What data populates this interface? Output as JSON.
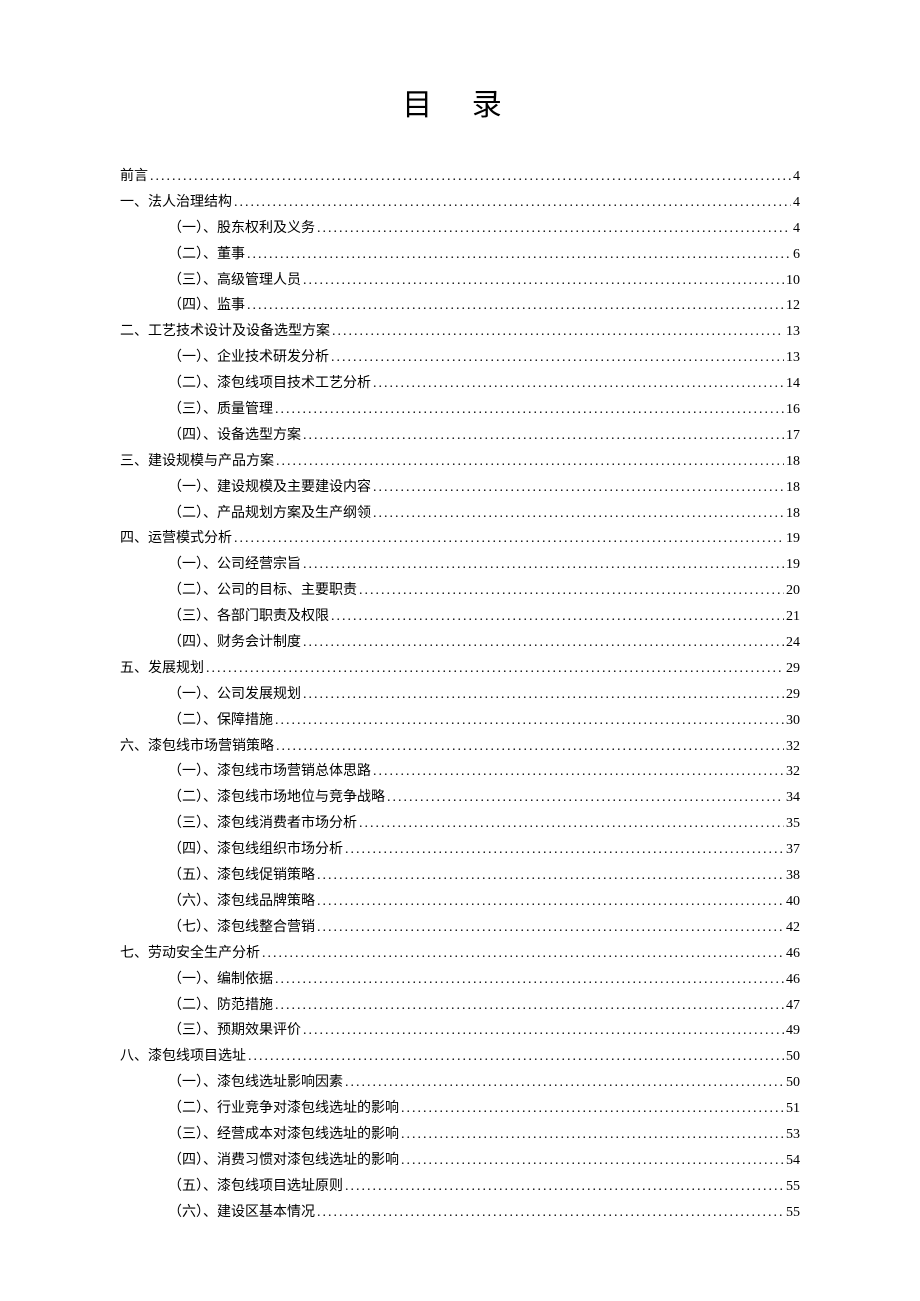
{
  "title": "目 录",
  "entries": [
    {
      "level": 0,
      "label": "前言",
      "page": "4"
    },
    {
      "level": 0,
      "label": "一、法人治理结构",
      "page": "4"
    },
    {
      "level": 1,
      "label": "（一）、股东权利及义务",
      "page": "4"
    },
    {
      "level": 1,
      "label": "（二）、董事",
      "page": "6"
    },
    {
      "level": 1,
      "label": "（三）、高级管理人员",
      "page": "10"
    },
    {
      "level": 1,
      "label": "（四）、监事",
      "page": "12"
    },
    {
      "level": 0,
      "label": "二、工艺技术设计及设备选型方案",
      "page": "13"
    },
    {
      "level": 1,
      "label": "（一）、企业技术研发分析",
      "page": "13"
    },
    {
      "level": 1,
      "label": "（二）、漆包线项目技术工艺分析",
      "page": "14"
    },
    {
      "level": 1,
      "label": "（三）、质量管理",
      "page": "16"
    },
    {
      "level": 1,
      "label": "（四）、设备选型方案",
      "page": "17"
    },
    {
      "level": 0,
      "label": "三、建设规模与产品方案",
      "page": "18"
    },
    {
      "level": 1,
      "label": "（一）、建设规模及主要建设内容",
      "page": "18"
    },
    {
      "level": 1,
      "label": "（二）、产品规划方案及生产纲领",
      "page": "18"
    },
    {
      "level": 0,
      "label": "四、运营模式分析",
      "page": "19"
    },
    {
      "level": 1,
      "label": "（一）、公司经营宗旨",
      "page": "19"
    },
    {
      "level": 1,
      "label": "（二）、公司的目标、主要职责",
      "page": "20"
    },
    {
      "level": 1,
      "label": "（三）、各部门职责及权限",
      "page": "21"
    },
    {
      "level": 1,
      "label": "（四）、财务会计制度",
      "page": "24"
    },
    {
      "level": 0,
      "label": "五、发展规划",
      "page": "29"
    },
    {
      "level": 1,
      "label": "（一）、公司发展规划",
      "page": "29"
    },
    {
      "level": 1,
      "label": "（二）、保障措施",
      "page": "30"
    },
    {
      "level": 0,
      "label": "六、漆包线市场营销策略",
      "page": "32"
    },
    {
      "level": 1,
      "label": "（一）、漆包线市场营销总体思路",
      "page": "32"
    },
    {
      "level": 1,
      "label": "（二）、漆包线市场地位与竞争战略",
      "page": "34"
    },
    {
      "level": 1,
      "label": "（三）、漆包线消费者市场分析",
      "page": "35"
    },
    {
      "level": 1,
      "label": "（四）、漆包线组织市场分析",
      "page": "37"
    },
    {
      "level": 1,
      "label": "（五）、漆包线促销策略",
      "page": "38"
    },
    {
      "level": 1,
      "label": "（六）、漆包线品牌策略",
      "page": "40"
    },
    {
      "level": 1,
      "label": "（七）、漆包线整合营销",
      "page": "42"
    },
    {
      "level": 0,
      "label": "七、劳动安全生产分析",
      "page": "46"
    },
    {
      "level": 1,
      "label": "（一）、编制依据",
      "page": "46"
    },
    {
      "level": 1,
      "label": "（二）、防范措施",
      "page": "47"
    },
    {
      "level": 1,
      "label": "（三）、预期效果评价",
      "page": "49"
    },
    {
      "level": 0,
      "label": "八、漆包线项目选址",
      "page": "50"
    },
    {
      "level": 1,
      "label": "（一）、漆包线选址影响因素",
      "page": "50"
    },
    {
      "level": 1,
      "label": "（二）、行业竞争对漆包线选址的影响",
      "page": "51"
    },
    {
      "level": 1,
      "label": "（三）、经营成本对漆包线选址的影响",
      "page": "53"
    },
    {
      "level": 1,
      "label": "（四）、消费习惯对漆包线选址的影响",
      "page": "54"
    },
    {
      "level": 1,
      "label": "（五）、漆包线项目选址原则",
      "page": "55"
    },
    {
      "level": 1,
      "label": "（六）、建设区基本情况",
      "page": "55"
    }
  ]
}
